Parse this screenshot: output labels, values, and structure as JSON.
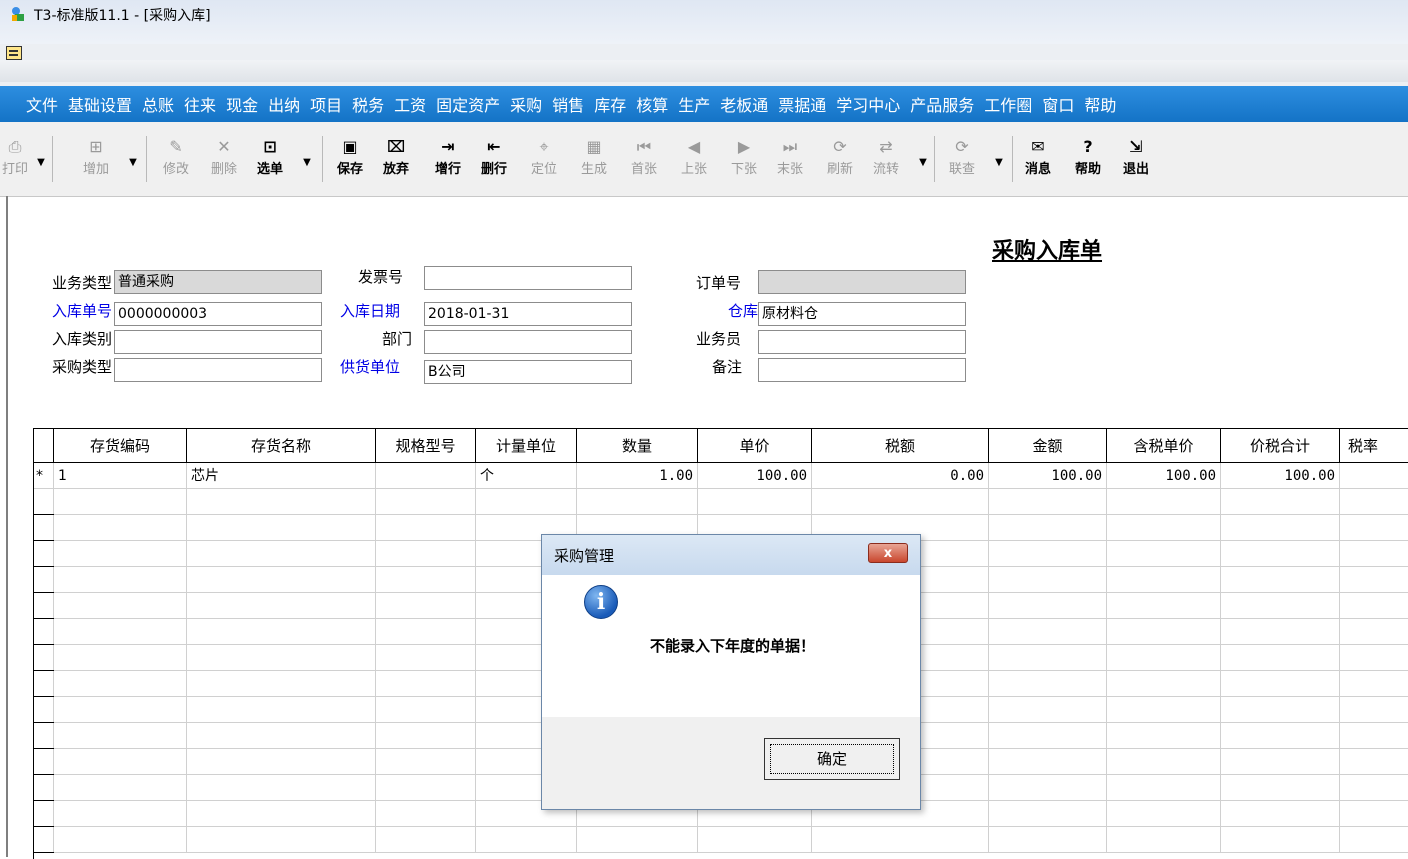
{
  "window": {
    "title": "T3-标准版11.1 - [采购入库]"
  },
  "menu": [
    "文件",
    "基础设置",
    "总账",
    "往来",
    "现金",
    "出纳",
    "项目",
    "税务",
    "工资",
    "固定资产",
    "采购",
    "销售",
    "库存",
    "核算",
    "生产",
    "老板通",
    "票据通",
    "学习中心",
    "产品服务",
    "工作圈",
    "窗口",
    "帮助"
  ],
  "toolbar": {
    "print": "打印",
    "add": "增加",
    "modify": "修改",
    "delete": "删除",
    "select": "选单",
    "save": "保存",
    "discard": "放弃",
    "add_row": "增行",
    "delete_row": "删行",
    "locate": "定位",
    "generate": "生成",
    "first": "首张",
    "prev": "上张",
    "next": "下张",
    "last": "末张",
    "refresh": "刷新",
    "flow": "流转",
    "link": "联查",
    "message": "消息",
    "help": "帮助",
    "exit": "退出"
  },
  "form": {
    "title": "采购入库单",
    "business_type_label": "业务类型",
    "business_type": "普通采购",
    "invoice_no_label": "发票号",
    "invoice_no": "",
    "order_no_label": "订单号",
    "order_no": "",
    "receipt_no_label": "入库单号",
    "receipt_no": "0000000003",
    "receipt_date_label": "入库日期",
    "receipt_date": "2018-01-31",
    "warehouse_label": "仓库",
    "warehouse": "原材料仓",
    "receipt_category_label": "入库类别",
    "receipt_category": "",
    "department_label": "部门",
    "department": "",
    "salesperson_label": "业务员",
    "salesperson": "",
    "purchase_type_label": "采购类型",
    "purchase_type": "",
    "supplier_label": "供货单位",
    "supplier": "B公司",
    "remark_label": "备注",
    "remark": ""
  },
  "grid": {
    "headers": [
      "存货编码",
      "存货名称",
      "规格型号",
      "计量单位",
      "数量",
      "单价",
      "税额",
      "金额",
      "含税单价",
      "价税合计",
      "税率"
    ],
    "rows": [
      {
        "marker": "*",
        "code": "1",
        "name": "芯片",
        "spec": "",
        "unit": "个",
        "qty": "1.00",
        "price": "100.00",
        "tax": "0.00",
        "amount": "100.00",
        "tax_price": "100.00",
        "total": "100.00",
        "rate": ""
      }
    ]
  },
  "dialog": {
    "title": "采购管理",
    "message": "不能录入下年度的单据！",
    "ok": "确定",
    "close": "x"
  },
  "colors": {
    "menu_bg": "#1a7fd3",
    "blue_label": "#0000e6"
  },
  "icons": [
    "app-icon",
    "document-icon",
    "info-icon",
    "close-icon"
  ]
}
